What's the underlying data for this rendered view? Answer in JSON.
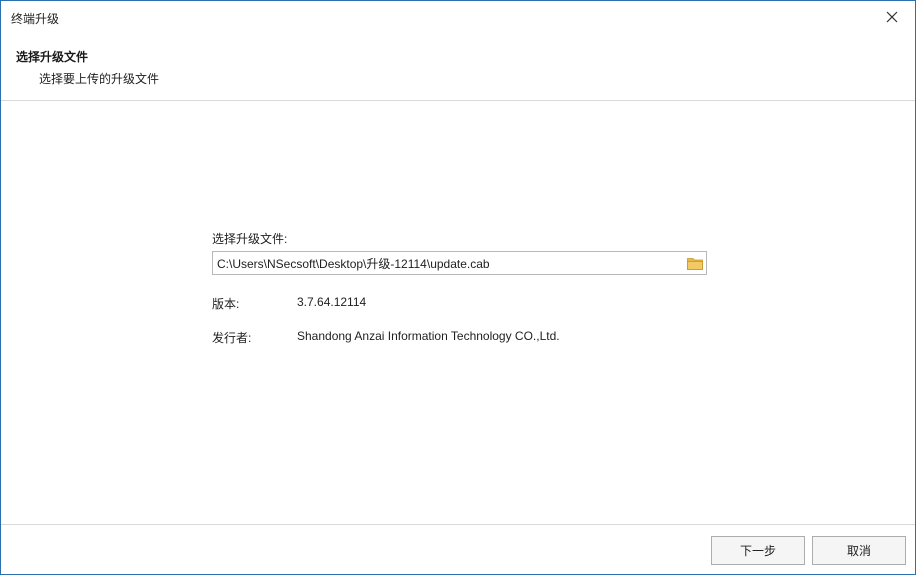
{
  "window": {
    "title": "终端升级",
    "close_icon": "close-icon",
    "border_color": "#2b6fb3"
  },
  "header": {
    "title": "选择升级文件",
    "subtitle": "选择要上传的升级文件"
  },
  "form": {
    "file_label": "选择升级文件:",
    "file_path": "C:\\Users\\NSecsoft\\Desktop\\升级-12114\\update.cab",
    "browse_icon": "folder-icon",
    "folder_color": "#e8b84a"
  },
  "info": {
    "version_label": "版本:",
    "version_value": "3.7.64.12114",
    "publisher_label": "发行者:",
    "publisher_value": "Shandong Anzai Information Technology CO.,Ltd."
  },
  "footer": {
    "next_label": "下一步",
    "cancel_label": "取消"
  }
}
